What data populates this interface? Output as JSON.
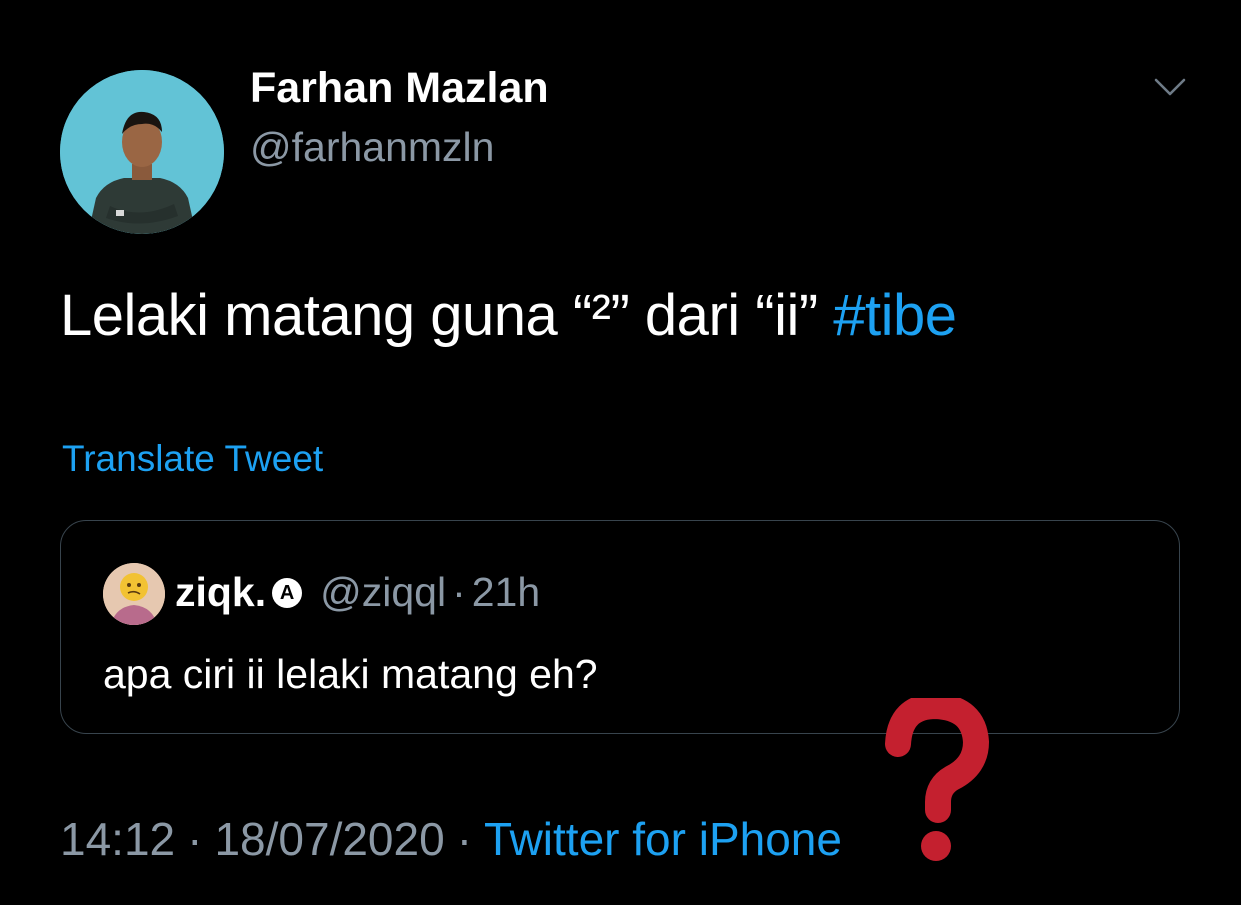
{
  "tweet": {
    "display_name": "Farhan Mazlan",
    "handle": "@farhanmzln",
    "text": "Lelaki matang guna “²” dari “ii” ",
    "hashtag": "#tibe",
    "translate_label": "Translate Tweet",
    "time": "14:12",
    "separator": "·",
    "date": "18/07/2020",
    "source": "Twitter for iPhone"
  },
  "quoted_tweet": {
    "display_name": "ziqk.",
    "badge": "A",
    "handle": "@ziqql",
    "separator": "·",
    "time": "21h",
    "text": "apa ciri ii lelaki matang eh?"
  },
  "icons": {
    "more": "chevron-down-icon",
    "overlay": "question-mark-icon"
  },
  "colors": {
    "background": "#000000",
    "link": "#1da1f2",
    "secondary_text": "#8b98a5",
    "border": "#38444d",
    "overlay_red": "#c4202f"
  }
}
